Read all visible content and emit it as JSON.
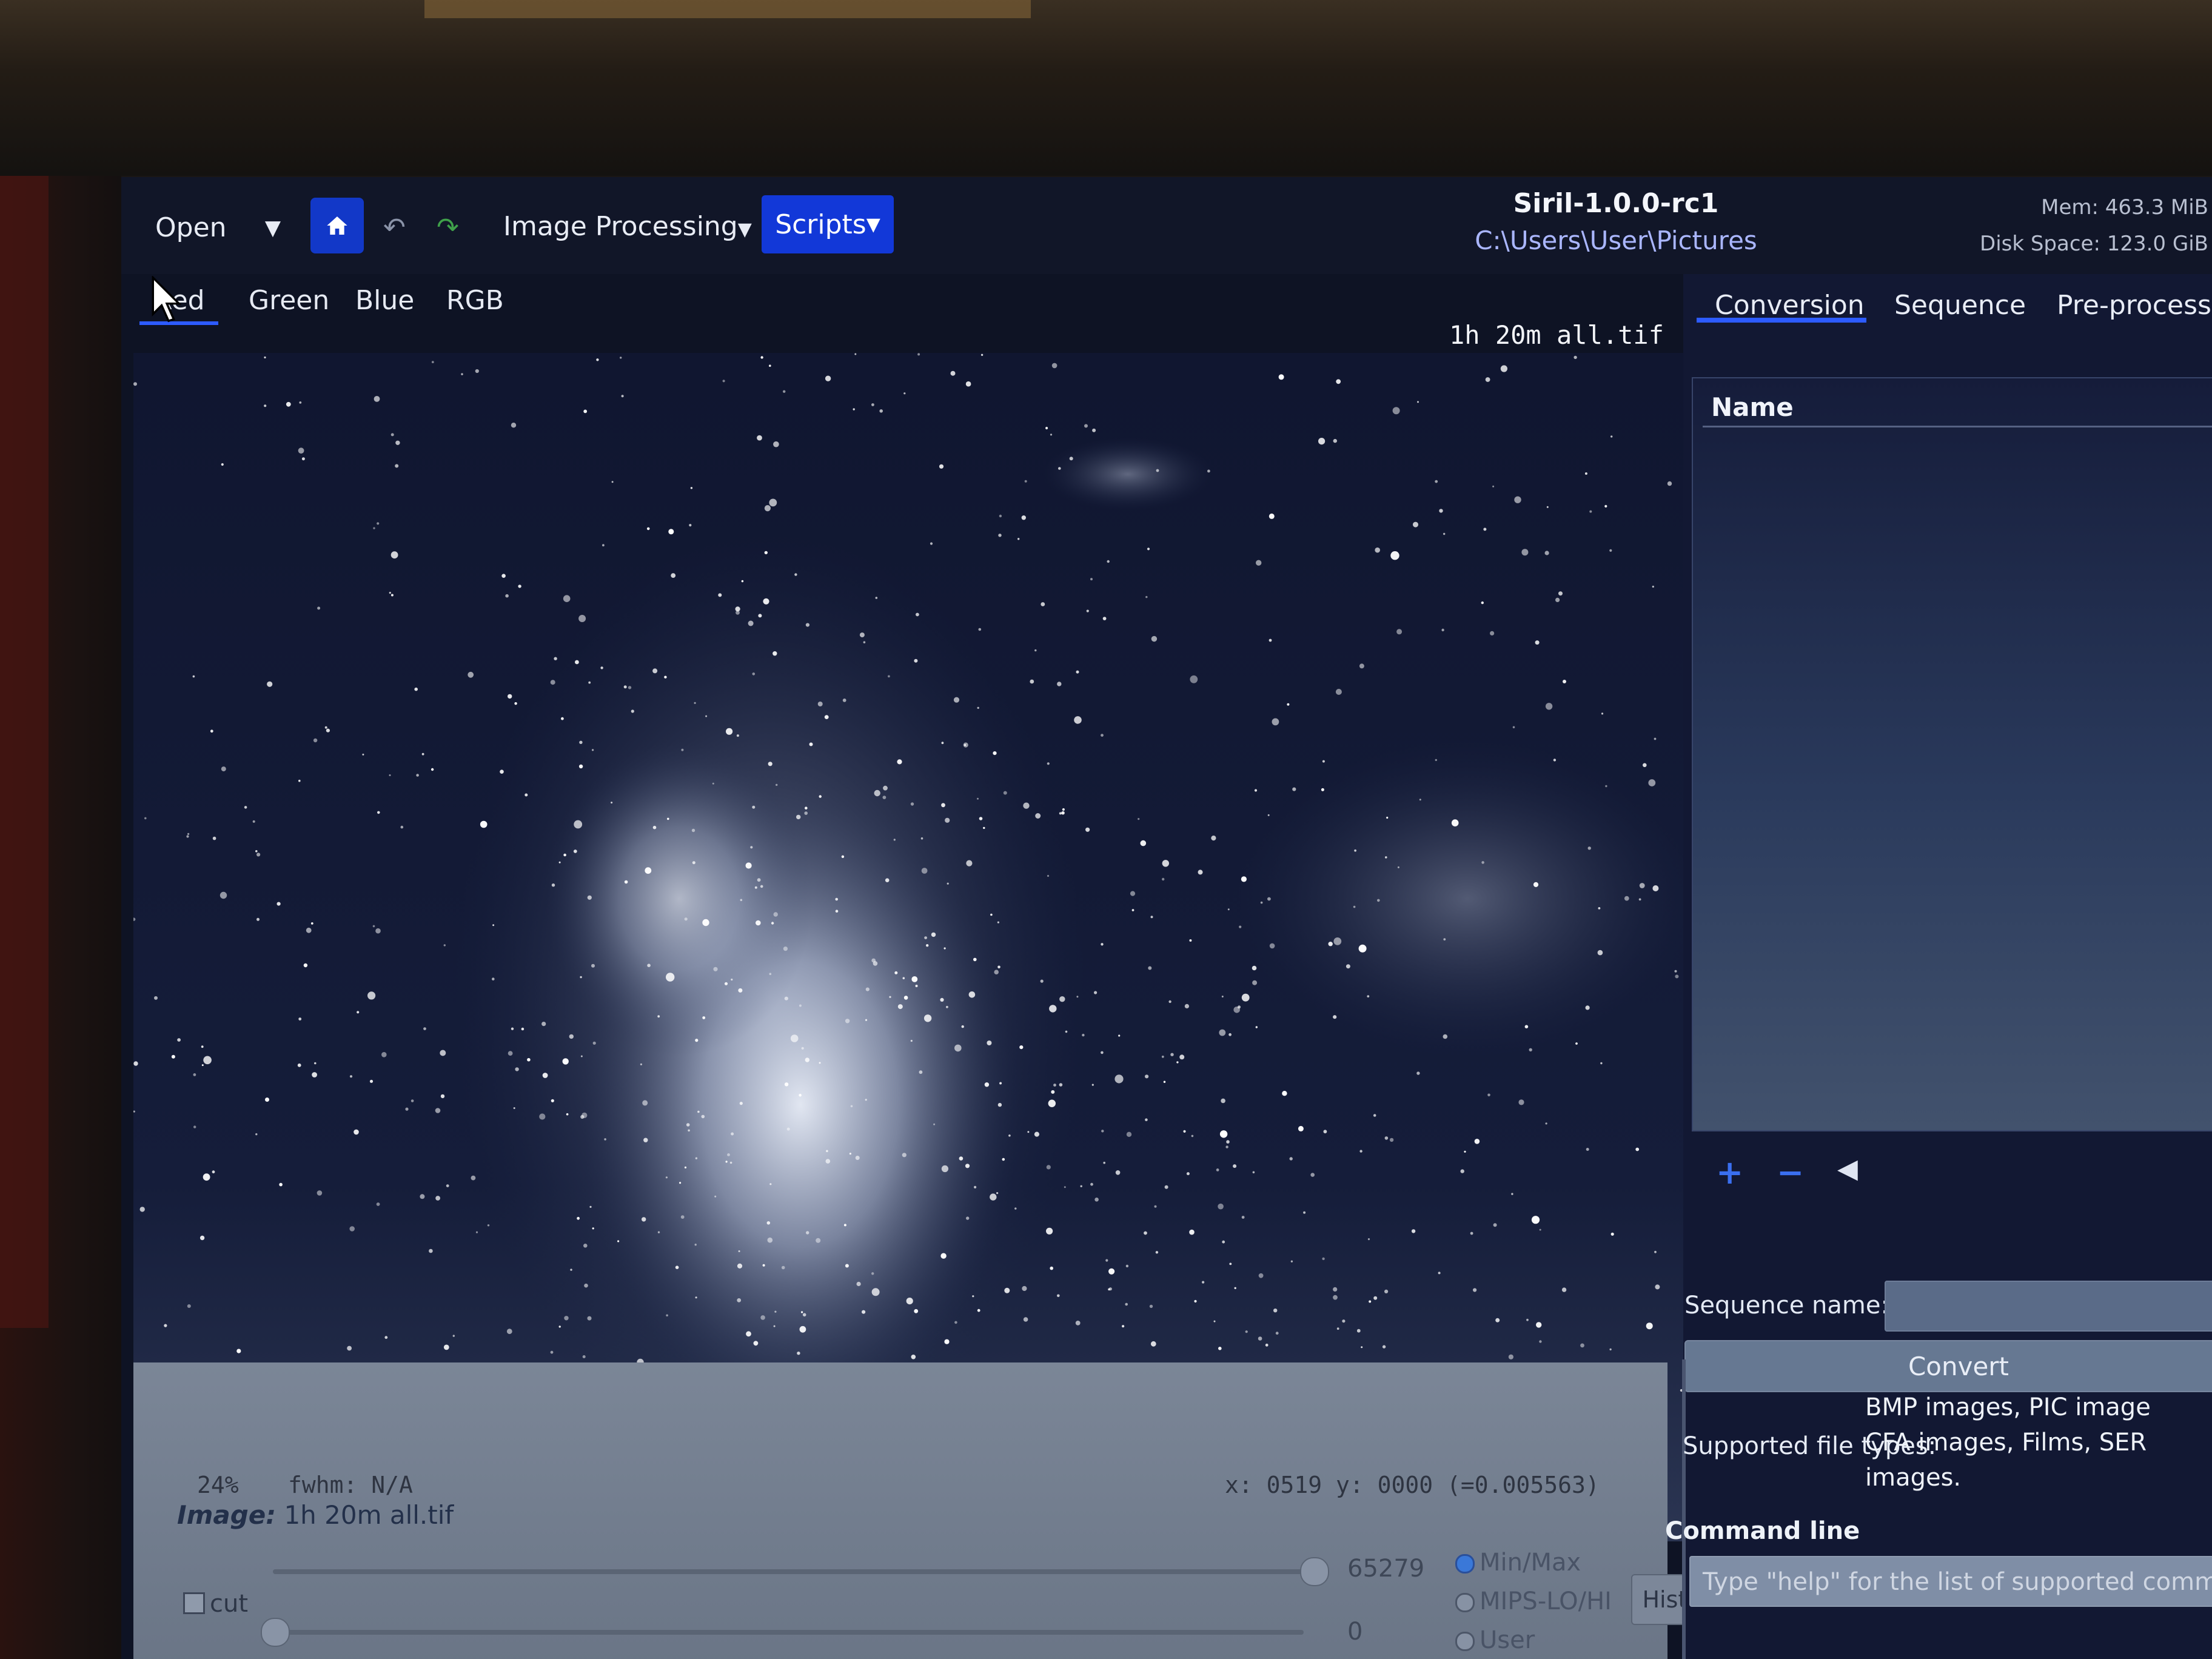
{
  "toolbar": {
    "open_label": "Open",
    "image_processing_label": "Image Processing",
    "scripts_label": "Scripts",
    "title": "Siril-1.0.0-rc1",
    "path": "C:\\Users\\User\\Pictures",
    "mem": "Mem: 463.3 MiB",
    "disk": "Disk Space: 123.0 GiB"
  },
  "channel_tabs": [
    "Red",
    "Green",
    "Blue",
    "RGB"
  ],
  "viewer": {
    "filename": "1h 20m all.tif",
    "zoom": "24%",
    "fwhm": "fwhm: N/A",
    "coords": "x: 0519 y: 0000 (=0.005563)"
  },
  "display_controls": {
    "image_label_prefix": "Image:",
    "image_name": "1h 20m all.tif",
    "hi_value": "65279",
    "lo_value": "0",
    "cut_label": "cut",
    "radios": [
      "Min/Max",
      "MIPS-LO/HI",
      "User"
    ],
    "selected_radio": "Min/Max",
    "histogram_label": "Histogram"
  },
  "right_panel": {
    "tabs": [
      "Conversion",
      "Sequence",
      "Pre-processin"
    ],
    "list_header": "Name",
    "sequence_name_label": "Sequence name:",
    "convert_label": "Convert",
    "supported_types_label": "Supported file types:",
    "supported_types_lines": [
      "BMP images, PIC image",
      "CFA images, Films, SER",
      "images."
    ],
    "command_line_label": "Command line",
    "command_placeholder": "Type \"help\" for the list of supported comman"
  },
  "colors": {
    "accent": "#1238d8",
    "tab_underline": "#2d5bff",
    "panel_bg": "#121833"
  }
}
